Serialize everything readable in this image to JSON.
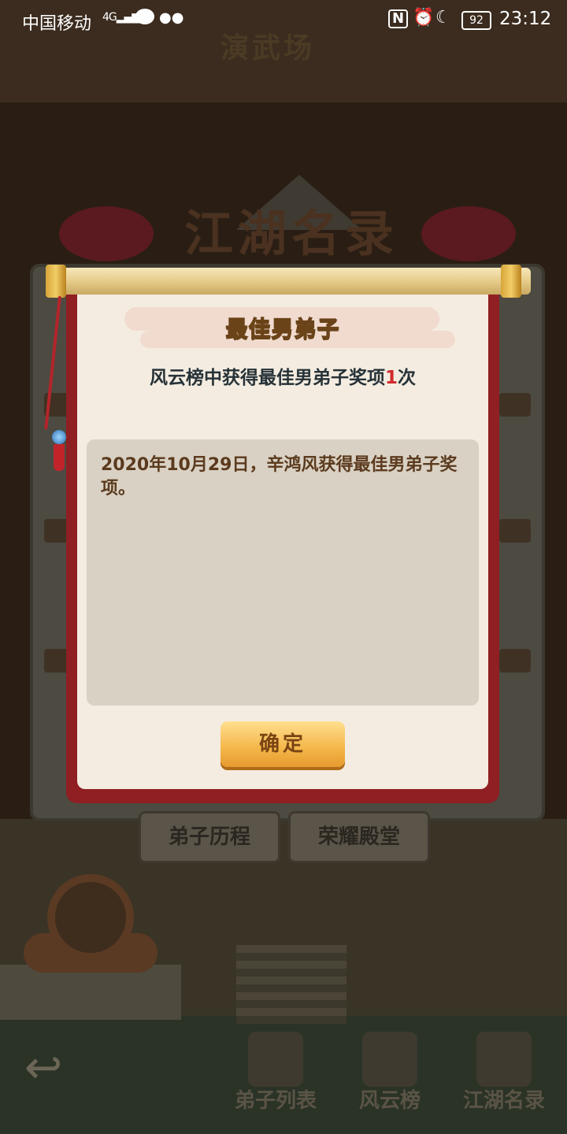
{
  "status_bar": {
    "carrier": "中国移动",
    "network": "4G",
    "battery": "92",
    "time": "23:12"
  },
  "background": {
    "page_title": "演武场",
    "panel_title": "江湖名录",
    "panel_tabs": [
      "弟子历程",
      "荣耀殿堂"
    ]
  },
  "bottom_nav": [
    {
      "label": "弟子列表",
      "icon": "disciple-icon"
    },
    {
      "label": "风云榜",
      "icon": "ranking-scroll-icon"
    },
    {
      "label": "江湖名录",
      "icon": "book-icon"
    }
  ],
  "dialog": {
    "title": "最佳男弟子",
    "summary_prefix": "风云榜中获得最佳男弟子奖项",
    "summary_count": "1",
    "summary_suffix": "次",
    "record": "2020年10月29日，辛鸿风获得最佳男弟子奖项。",
    "confirm_label": "确定"
  },
  "colors": {
    "scroll_border": "#8f1f22",
    "paper": "#f4ece0",
    "record_box": "#d9d1c3",
    "confirm_button": "#f4b648",
    "count_highlight": "#d12b2b"
  }
}
